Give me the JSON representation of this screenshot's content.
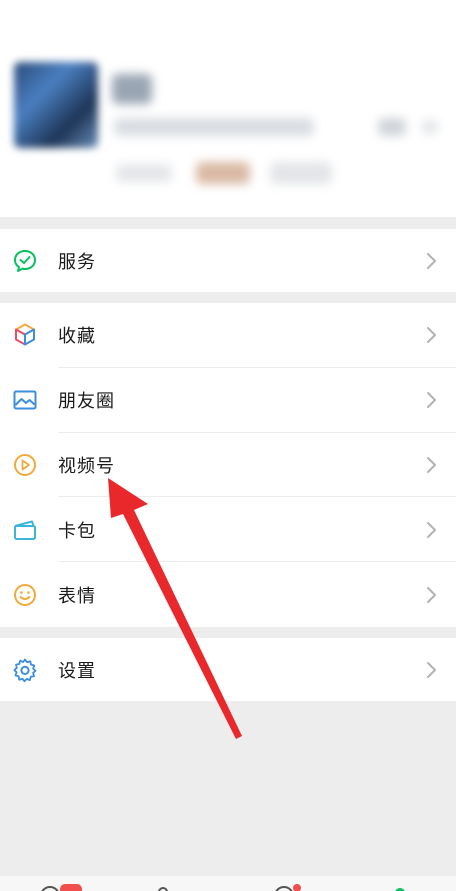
{
  "menu": {
    "services": {
      "label": "服务",
      "icon": "wechat-pay-icon"
    },
    "items": [
      {
        "label": "收藏",
        "icon": "favorites-cube-icon"
      },
      {
        "label": "朋友圈",
        "icon": "moments-image-icon"
      },
      {
        "label": "视频号",
        "icon": "channels-play-icon"
      },
      {
        "label": "卡包",
        "icon": "card-wallet-icon"
      },
      {
        "label": "表情",
        "icon": "sticker-smiley-icon"
      }
    ],
    "settings": {
      "label": "设置",
      "icon": "settings-gear-icon"
    }
  },
  "colors": {
    "accent_green": "#07c160",
    "annotation_red": "#e8282b",
    "background": "#ededed",
    "chevron": "#b2b2b2"
  }
}
